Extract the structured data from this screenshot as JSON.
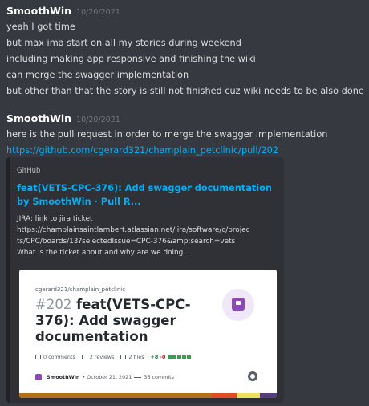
{
  "messages": [
    {
      "author": "SmoothWin",
      "timestamp": "10/20/2021",
      "lines": [
        "yeah I got time",
        "but max ima start on all my stories during weekend",
        "including making app responsive and finishing the wiki",
        "can merge the swagger implementation",
        "but other than that the story is still not finished cuz wiki needs to be also done"
      ]
    },
    {
      "author": "SmoothWin",
      "timestamp": "10/20/2021",
      "lines": [
        "here is the pull request in order to merge the swagger implementation"
      ],
      "link": "https://github.com/cgerard321/champlain_petclinic/pull/202"
    }
  ],
  "embed": {
    "provider": "GitHub",
    "title": "feat(VETS-CPC-376): Add swagger documentation by SmoothWin · Pull R...",
    "description_lines": [
      "JIRA: link to jira ticket",
      "https://champlainsaintlambert.atlassian.net/jira/software/c/projec",
      "ts/CPC/boards/13?selectedIssue=CPC-376&amp;search=vets",
      "What is the ticket about and why are we doing ..."
    ],
    "card": {
      "repo": "cgerard321/champlain_petclinic",
      "pr_number": "#202",
      "pr_title": "feat(VETS-CPC-376): Add swagger documentation",
      "comments": "0 comments",
      "reviews": "2 reviews",
      "files": "2 files",
      "additions": "+8",
      "deletions": "-0",
      "author": "SmoothWin",
      "date": "• October 21, 2021",
      "commits": "36 commits",
      "accent_color": "#8a4bb7",
      "lang_colors": [
        "#b07219",
        "#e34c26",
        "#f1e05a",
        "#563d7c"
      ]
    }
  },
  "theme": {
    "background": "#36393f",
    "embed_background": "#2f3136",
    "link": "#00aff4"
  }
}
